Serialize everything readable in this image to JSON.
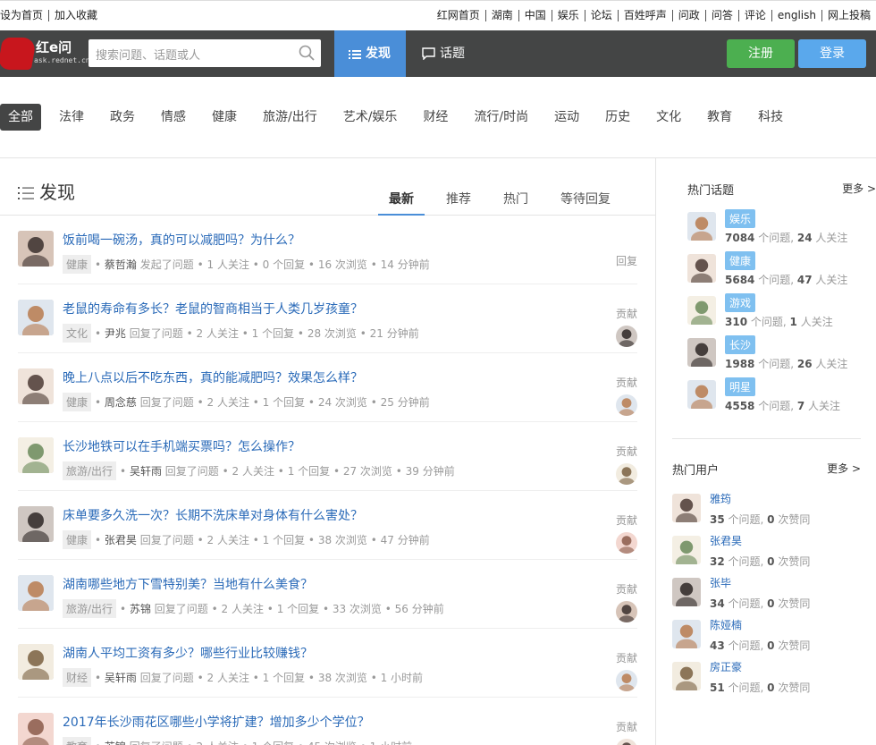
{
  "topbar": {
    "left": [
      "设为首页",
      "加入收藏"
    ],
    "right": [
      "红网首页",
      "湖南",
      "中国",
      "娱乐",
      "论坛",
      "百姓呼声",
      "问政",
      "问答",
      "评论",
      "english",
      "网上投稿"
    ]
  },
  "header": {
    "logo_title": "红e问",
    "logo_sub": "ask.rednet.cn",
    "search_placeholder": "搜索问题、话题或人",
    "nav": [
      "发现",
      "话题"
    ],
    "register": "注册",
    "login": "登录"
  },
  "categories": [
    "全部",
    "法律",
    "政务",
    "情感",
    "健康",
    "旅游/出行",
    "艺术/娱乐",
    "财经",
    "流行/时尚",
    "运动",
    "历史",
    "文化",
    "教育",
    "科技"
  ],
  "main": {
    "title": "发现",
    "tabs": [
      "最新",
      "推荐",
      "热门",
      "等待回复"
    ],
    "items": [
      {
        "q": "饭前喝一碗汤，真的可以减肥吗？为什么？",
        "tag": "健康",
        "user": "蔡哲瀚",
        "action": "发起了问题",
        "stats": "• 1 人关注 • 0 个回复 • 16 次浏览 • 14 分钟前",
        "right": "回复"
      },
      {
        "q": "老鼠的寿命有多长？老鼠的智商相当于人类几岁孩童？",
        "tag": "文化",
        "user": "尹兆",
        "action": "回复了问题",
        "stats": "• 2 人关注 • 1 个回复 • 28 次浏览 • 21 分钟前",
        "right": "贡献"
      },
      {
        "q": "晚上八点以后不吃东西，真的能减肥吗？效果怎么样？",
        "tag": "健康",
        "user": "周念慈",
        "action": "回复了问题",
        "stats": "• 2 人关注 • 1 个回复 • 24 次浏览 • 25 分钟前",
        "right": "贡献"
      },
      {
        "q": "长沙地铁可以在手机端买票吗？怎么操作？",
        "tag": "旅游/出行",
        "user": "吴轩雨",
        "action": "回复了问题",
        "stats": "• 2 人关注 • 1 个回复 • 27 次浏览 • 39 分钟前",
        "right": "贡献"
      },
      {
        "q": "床单要多久洗一次？长期不洗床单对身体有什么害处？",
        "tag": "健康",
        "user": "张君昊",
        "action": "回复了问题",
        "stats": "• 2 人关注 • 1 个回复 • 38 次浏览 • 47 分钟前",
        "right": "贡献"
      },
      {
        "q": "湖南哪些地方下雪特别美？当地有什么美食？",
        "tag": "旅游/出行",
        "user": "苏锦",
        "action": "回复了问题",
        "stats": "• 2 人关注 • 1 个回复 • 33 次浏览 • 56 分钟前",
        "right": "贡献"
      },
      {
        "q": "湖南人平均工资有多少？哪些行业比较赚钱？",
        "tag": "财经",
        "user": "吴轩雨",
        "action": "回复了问题",
        "stats": "• 2 人关注 • 1 个回复 • 38 次浏览 • 1 小时前",
        "right": "贡献"
      },
      {
        "q": "2017年长沙雨花区哪些小学将扩建？增加多少个学位？",
        "tag": "教育",
        "user": "苏锦",
        "action": "回复了问题",
        "stats": "• 2 人关注 • 1 个回复 • 45 次浏览 • 1 小时前",
        "right": "贡献"
      }
    ]
  },
  "sidebar": {
    "topics_title": "热门话题",
    "topics_more": "更多 >",
    "topics": [
      {
        "name": "娱乐",
        "q": "7084",
        "f": "24"
      },
      {
        "name": "健康",
        "q": "5684",
        "f": "47"
      },
      {
        "name": "游戏",
        "q": "310",
        "f": "1"
      },
      {
        "name": "长沙",
        "q": "1988",
        "f": "26"
      },
      {
        "name": "明星",
        "q": "4558",
        "f": "7"
      }
    ],
    "topic_q_suffix": " 个问题, ",
    "topic_f_suffix": " 人关注",
    "users_title": "热门用户",
    "users_more": "更多 >",
    "users": [
      {
        "name": "雅筠",
        "q": "35",
        "l": "0"
      },
      {
        "name": "张君昊",
        "q": "32",
        "l": "0"
      },
      {
        "name": "张毕",
        "q": "34",
        "l": "0"
      },
      {
        "name": "陈娅楠",
        "q": "43",
        "l": "0"
      },
      {
        "name": "房正豪",
        "q": "51",
        "l": "0"
      }
    ],
    "user_q_suffix": " 个问题, ",
    "user_l_suffix": " 次赞同"
  }
}
